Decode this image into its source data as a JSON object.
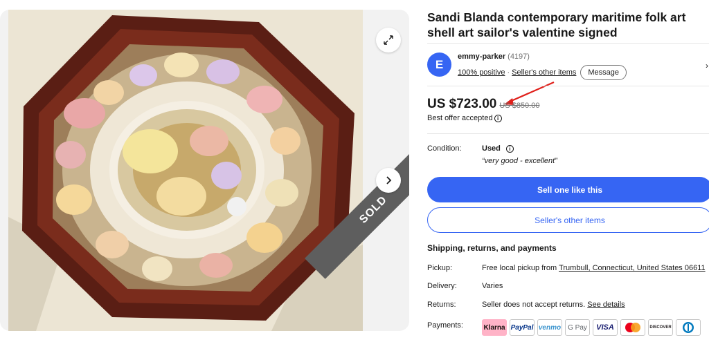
{
  "listing": {
    "title": "Sandi Blanda contemporary maritime folk art shell art sailor's valentine signed",
    "sold_label": "SOLD"
  },
  "seller": {
    "initial": "E",
    "name": "emmy-parker",
    "feedback_count": "(4197)",
    "positive": "100% positive",
    "separator": "·",
    "other_items": "Seller's other items",
    "message": "Message"
  },
  "price": {
    "current": "US $723.00",
    "original": "US $850.00",
    "offer_status": "Best offer accepted"
  },
  "condition": {
    "label": "Condition:",
    "value": "Used",
    "note": "“very good - excellent”"
  },
  "actions": {
    "sell_one": "Sell one like this",
    "sellers_other": "Seller's other items"
  },
  "shipping": {
    "heading": "Shipping, returns, and payments",
    "pickup_label": "Pickup:",
    "pickup_prefix": "Free local pickup from ",
    "pickup_location": "Trumbull, Connecticut, United States 06611",
    "delivery_label": "Delivery:",
    "delivery_value": "Varies",
    "returns_label": "Returns:",
    "returns_value": "Seller does not accept returns. ",
    "returns_link": "See details",
    "payments_label": "Payments:",
    "payment_methods": [
      "Klarna",
      "PayPal",
      "venmo",
      "G Pay",
      "VISA",
      "Mastercard",
      "DISCOVER",
      "Diners Club"
    ]
  },
  "colors": {
    "accent": "#3665f3",
    "annotation_arrow": "#e0201b"
  },
  "icons": [
    "expand-icon",
    "chevron-right-icon",
    "info-icon",
    "chevron-right-icon"
  ]
}
